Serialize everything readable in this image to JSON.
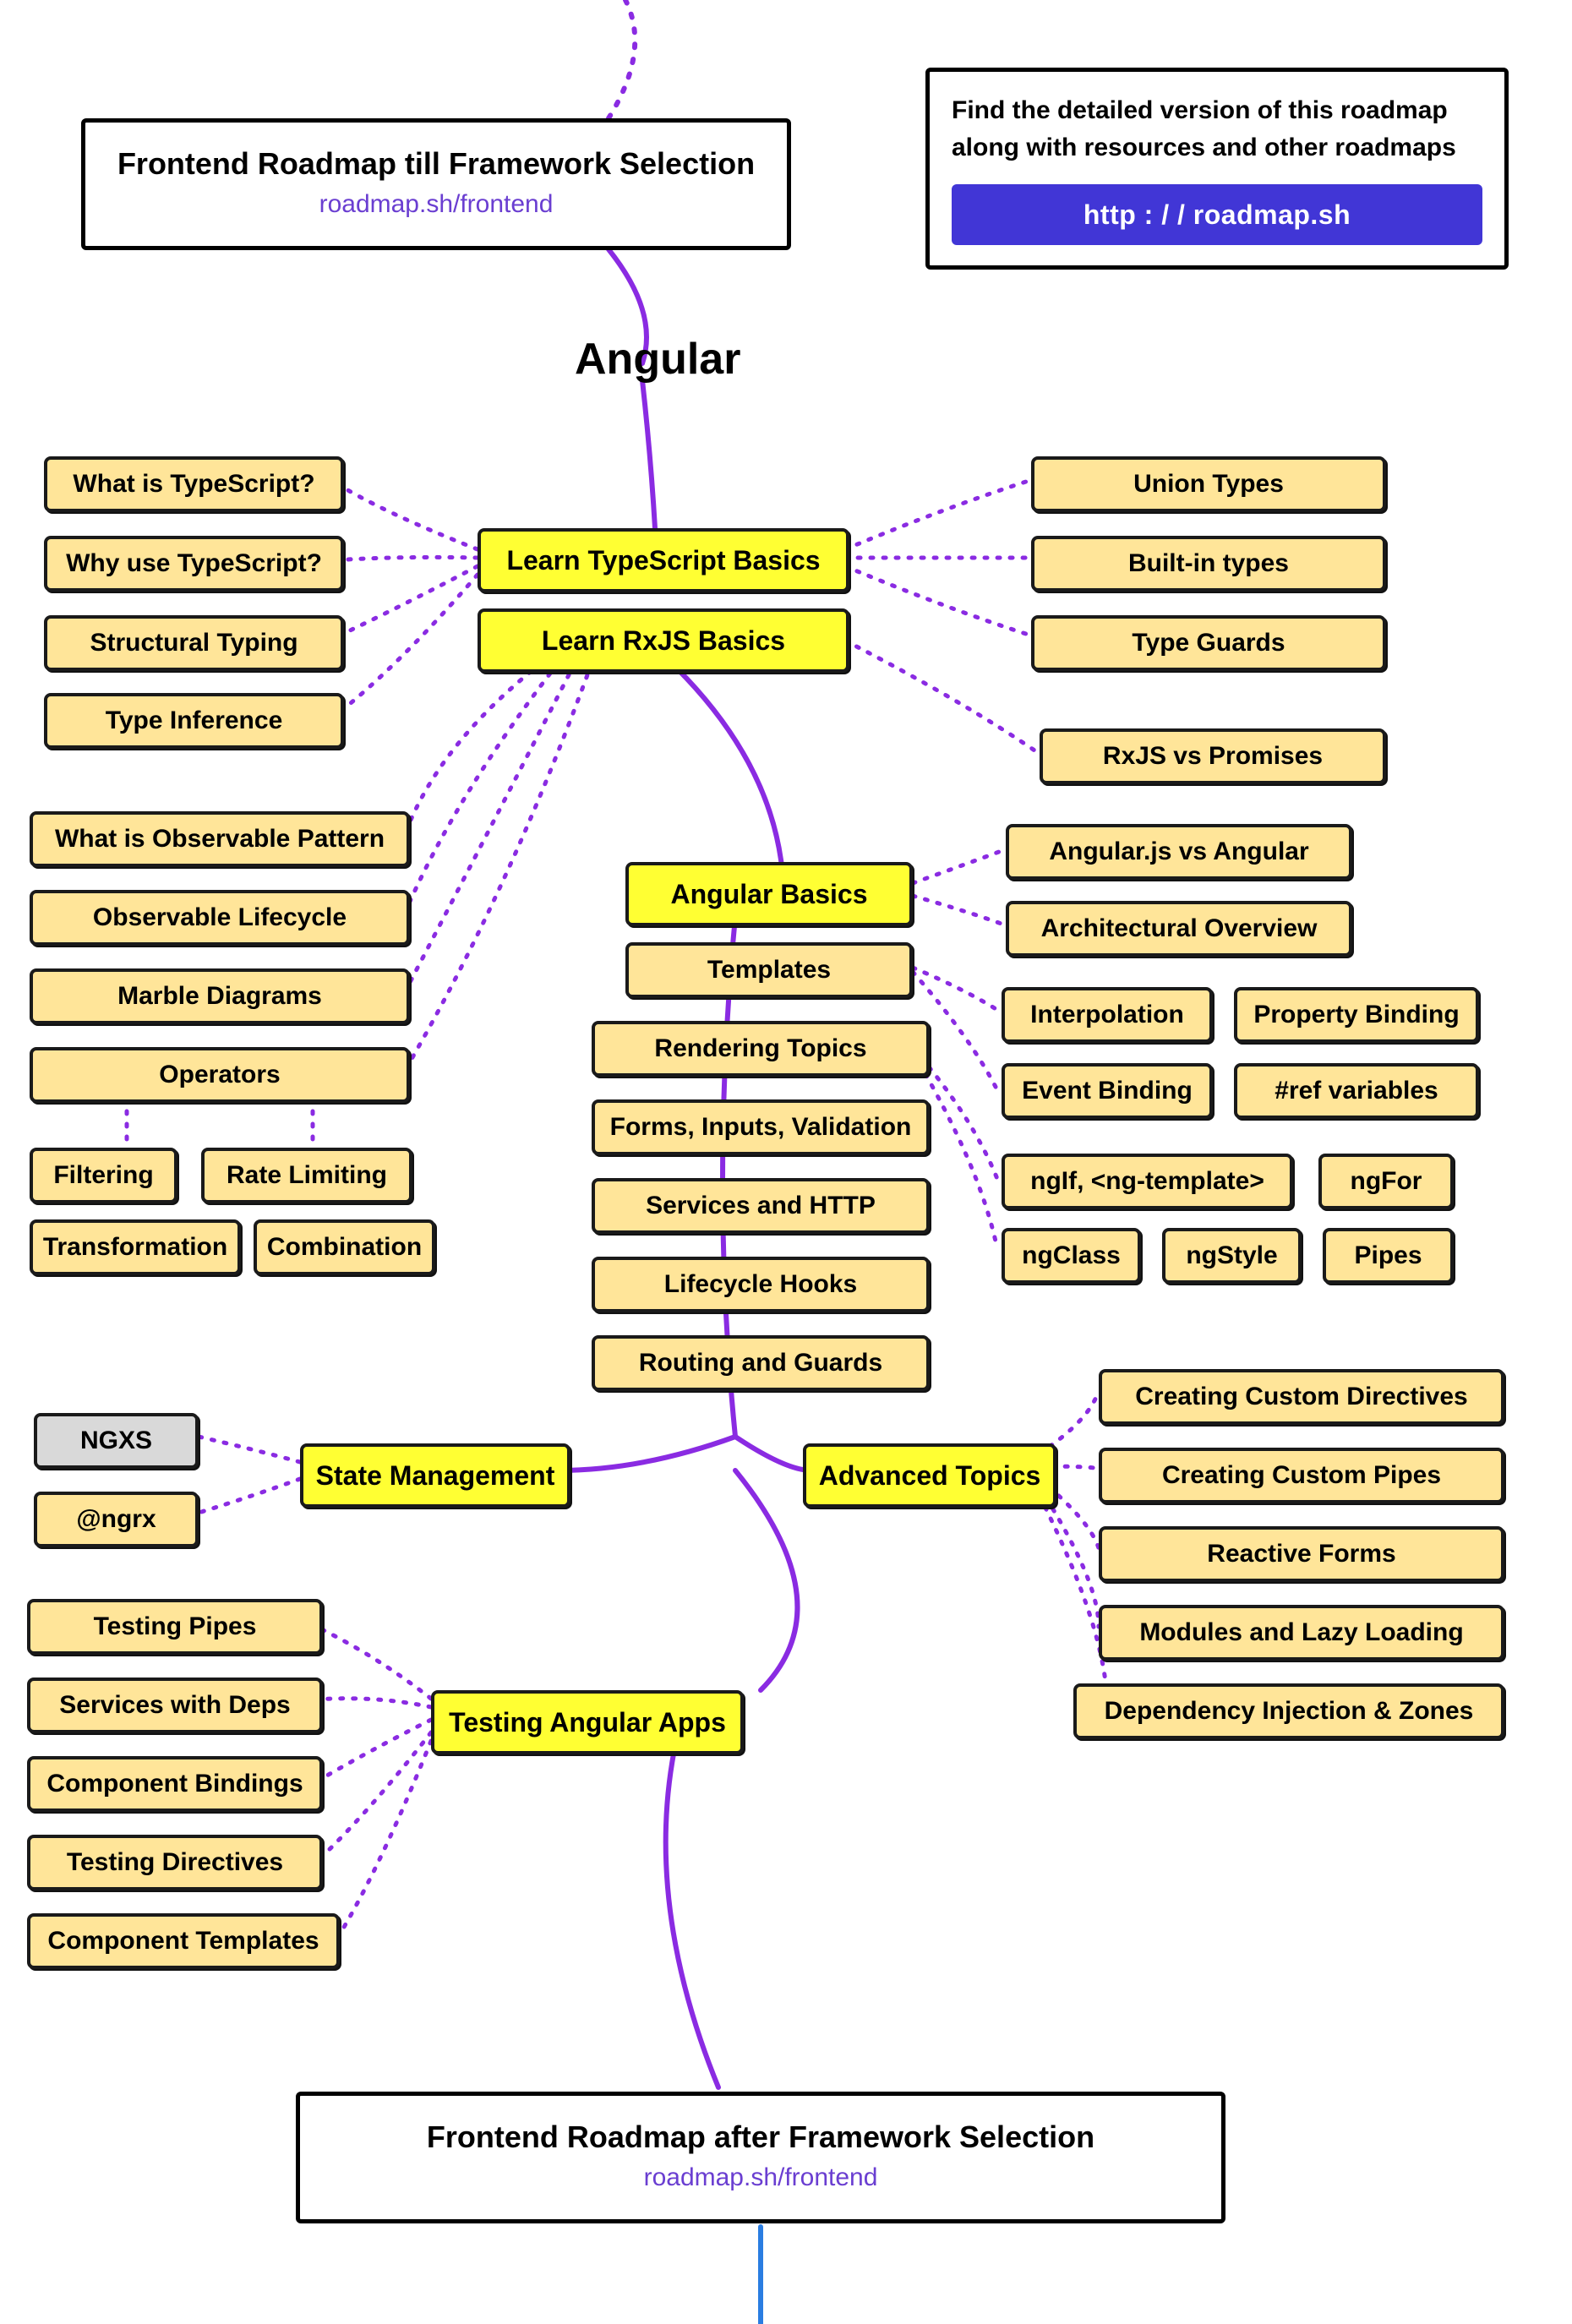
{
  "title": "Angular",
  "topCard": {
    "title": "Frontend Roadmap till Framework Selection",
    "sub": "roadmap.sh/frontend"
  },
  "promo": {
    "text1": "Find the detailed version of this roadmap",
    "text2": "along with resources and other roadmaps",
    "button": "http : / / roadmap.sh"
  },
  "bottomCard": {
    "title": "Frontend Roadmap after Framework Selection",
    "sub": "roadmap.sh/frontend"
  },
  "majors": {
    "tsBasics": "Learn TypeScript Basics",
    "rxBasics": "Learn RxJS Basics",
    "ngBasics": "Angular Basics",
    "state": "State Management",
    "advanced": "Advanced Topics",
    "testing": "Testing Angular Apps"
  },
  "tsLeft": [
    "What is TypeScript?",
    "Why use TypeScript?",
    "Structural Typing",
    "Type Inference"
  ],
  "tsRight": [
    "Union Types",
    "Built-in types",
    "Type Guards"
  ],
  "rxRight": "RxJS vs Promises",
  "rxLeft": [
    "What is Observable Pattern",
    "Observable Lifecycle",
    "Marble Diagrams",
    "Operators"
  ],
  "operatorsRow1": [
    "Filtering",
    "Rate Limiting"
  ],
  "operatorsRow2": [
    "Transformation",
    "Combination"
  ],
  "ngCenter": [
    "Templates",
    "Rendering Topics",
    "Forms, Inputs, Validation",
    "Services and HTTP",
    "Lifecycle Hooks",
    "Routing and Guards"
  ],
  "ngRightTop": [
    "Angular.js vs Angular",
    "Architectural Overview"
  ],
  "ngTplRow1": [
    "Interpolation",
    "Property Binding"
  ],
  "ngTplRow2": [
    "Event Binding",
    "#ref variables"
  ],
  "ngRenderRow1": [
    "ngIf, <ng-template>",
    "ngFor"
  ],
  "ngRenderRow2": [
    "ngClass",
    "ngStyle",
    "Pipes"
  ],
  "stateLeft": [
    "NGXS",
    "@ngrx"
  ],
  "advancedRight": [
    "Creating Custom Directives",
    "Creating Custom Pipes",
    "Reactive Forms",
    "Modules and Lazy Loading",
    "Dependency Injection & Zones"
  ],
  "testingLeft": [
    "Testing Pipes",
    "Services with Deps",
    "Component Bindings",
    "Testing Directives",
    "Component Templates"
  ]
}
